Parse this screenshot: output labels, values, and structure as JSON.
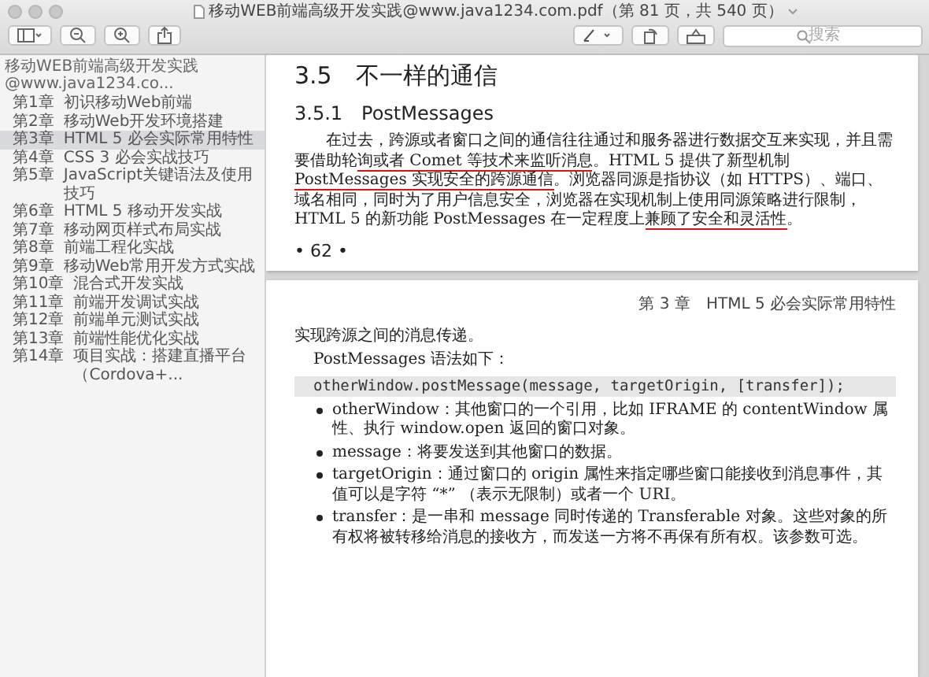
{
  "window": {
    "title": "移动WEB前端高级开发实践@www.java1234.com.pdf（第 81 页，共 540 页）"
  },
  "toolbar": {
    "search": {
      "placeholder": "搜索"
    }
  },
  "sidebar": {
    "document": "移动WEB前端高级开发实践@www.java1234.co...",
    "items": [
      {
        "number": "第1章",
        "label": "初识移动Web前端",
        "selected": false
      },
      {
        "number": "第2章",
        "label": "移动Web开发环境搭建",
        "selected": false
      },
      {
        "number": "第3章",
        "label": "HTML 5 必会实际常用特性",
        "selected": true
      },
      {
        "number": "第4章",
        "label": "CSS 3 必会实战技巧",
        "selected": false
      },
      {
        "number": "第5章",
        "label": "JavaScript关键语法及使用技巧",
        "selected": false
      },
      {
        "number": "第6章",
        "label": "HTML 5 移动开发实战",
        "selected": false
      },
      {
        "number": "第7章",
        "label": "移动网页样式布局实战",
        "selected": false
      },
      {
        "number": "第8章",
        "label": "前端工程化实战",
        "selected": false
      },
      {
        "number": "第9章",
        "label": "移动Web常用开发方式实战",
        "selected": false
      },
      {
        "number": "第10章",
        "label": "混合式开发实战",
        "selected": false
      },
      {
        "number": "第11章",
        "label": "前端开发调试实战",
        "selected": false
      },
      {
        "number": "第12章",
        "label": "前端单元测试实战",
        "selected": false
      },
      {
        "number": "第13章",
        "label": "前端性能优化实战",
        "selected": false
      },
      {
        "number": "第14章",
        "label": "项目实战：搭建直播平台（Cordova+...",
        "selected": false
      }
    ]
  },
  "pages": [
    {
      "section_heading": "3.5　不一样的通信",
      "subsection_heading": "3.5.1　PostMessages",
      "paragraph": [
        {
          "text": "在过去，跨源或者窗口之间的通信往往通过和服务器进行数据交互来实现，并且需要借助轮",
          "underlined": false
        },
        {
          "text": "询或者 Comet 等技术来监听消息",
          "underlined": true
        },
        {
          "text": "。HTML 5 提供了新型机制 ",
          "underlined": false
        },
        {
          "text": "PostMessages 实现安全的跨源通信",
          "underlined": true
        },
        {
          "text": "。浏览器同源是指协议（如 HTTPS）、端口、域名相同，同时为了用户信息安全，浏览器在实现机制上使用同源策略进行限制，HTML 5 的新功能 PostMessages 在一定程度上",
          "underlined": false
        },
        {
          "text": "兼顾了安全和灵活性",
          "underlined": true
        },
        {
          "text": "。",
          "underlined": false
        }
      ],
      "page_number": "• 62 •"
    },
    {
      "running_header": "第 3 章　HTML 5 必会实际常用特性",
      "continued_text": "实现跨源之间的消息传递。",
      "syntax_intro": "PostMessages 语法如下：",
      "code": "otherWindow.postMessage(message, targetOrigin, [transfer]);",
      "bullets": [
        "otherWindow：其他窗口的一个引用，比如 IFRAME 的 contentWindow 属性、执行 window.open 返回的窗口对象。",
        "message：将要发送到其他窗口的数据。",
        "targetOrigin：通过窗口的 origin 属性来指定哪些窗口能接收到消息事件，其值可以是字符 “*” （表示无限制）或者一个 URI。",
        "transfer：是一串和 message 同时传递的 Transferable 对象。这些对象的所有权将被转移给消息的接收方，而发送一方将不再保有所有权。该参数可选。"
      ]
    }
  ]
}
